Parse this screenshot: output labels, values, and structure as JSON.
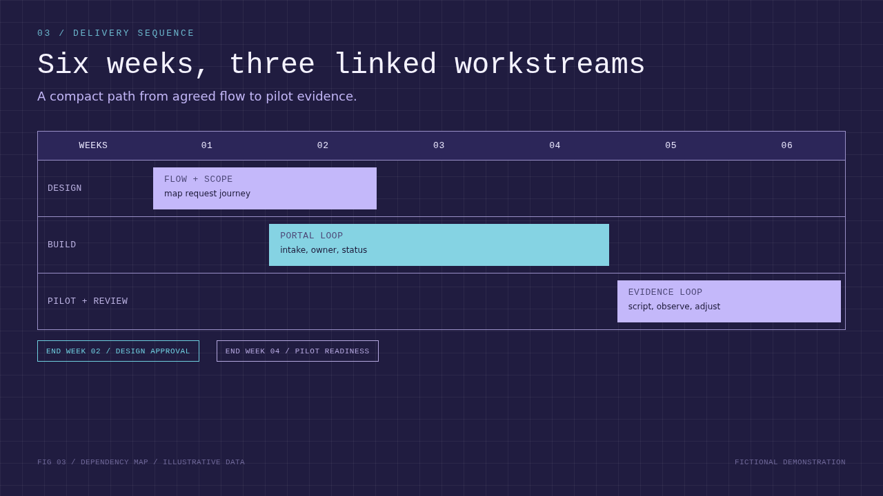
{
  "header": {
    "eyebrow": "03 / DELIVERY SEQUENCE",
    "title": "Six weeks, three linked workstreams",
    "subtitle": "A compact path from agreed flow to pilot evidence."
  },
  "timeline": {
    "label_heading": "WEEKS",
    "weeks": [
      "01",
      "02",
      "03",
      "04",
      "05",
      "06"
    ],
    "rows": [
      {
        "label": "DESIGN",
        "task": {
          "title": "FLOW + SCOPE",
          "description": "map request journey",
          "color": "#c4b8fa"
        }
      },
      {
        "label": "BUILD",
        "task": {
          "title": "PORTAL LOOP",
          "description": "intake, owner, status",
          "color": "#85d3e3"
        }
      },
      {
        "label": "PILOT + REVIEW",
        "task": {
          "title": "EVIDENCE LOOP",
          "description": "script, observe, adjust",
          "color": "#c4b8fa"
        }
      }
    ]
  },
  "milestones": [
    {
      "label": "END WEEK 02 / DESIGN APPROVAL",
      "color": "#6fcfe0"
    },
    {
      "label": "END WEEK 04 / PILOT READINESS",
      "color": "#b5a8e0"
    }
  ],
  "footer": {
    "caption": "FIG 03 / DEPENDENCY MAP / ILLUSTRATIVE DATA",
    "note": "FICTIONAL DEMONSTRATION"
  }
}
